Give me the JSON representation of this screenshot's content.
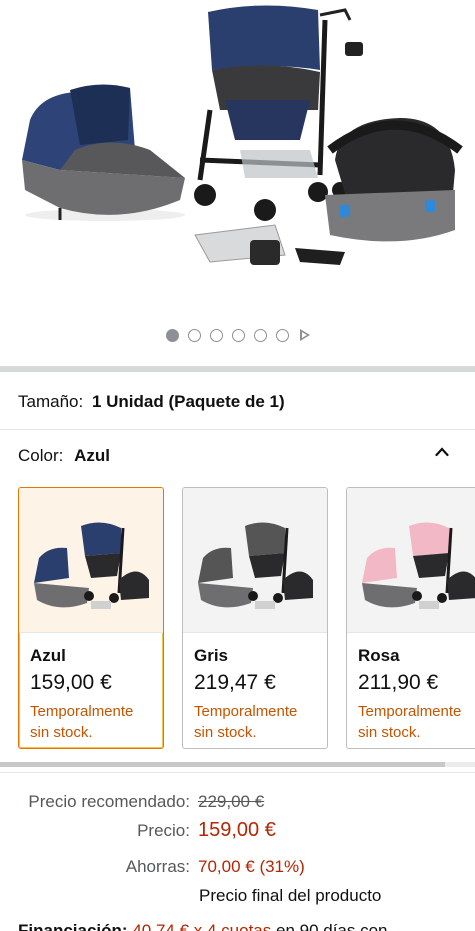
{
  "gallery": {
    "dots_total": 6,
    "active_index": 0,
    "play_icon": "play-icon"
  },
  "size": {
    "label": "Tamaño:",
    "value": "1 Unidad (Paquete de 1)"
  },
  "color": {
    "label": "Color:",
    "value": "Azul"
  },
  "swatches": [
    {
      "name": "Azul",
      "price": "159,00 €",
      "stock_line1": "Temporalmente",
      "stock_line2": "sin stock.",
      "accent": "#2b3f6e"
    },
    {
      "name": "Gris",
      "price": "219,47 €",
      "stock_line1": "Temporalmente",
      "stock_line2": "sin stock.",
      "accent": "#555555"
    },
    {
      "name": "Rosa",
      "price": "211,90 €",
      "stock_line1": "Temporalmente",
      "stock_line2": "sin stock.",
      "accent": "#f2b8c6"
    }
  ],
  "pricing": {
    "recommended_label": "Precio recomendado:",
    "recommended_value": "229,00 €",
    "price_label": "Precio:",
    "price_value": "159,00 €",
    "savings_label": "Ahorras:",
    "savings_value": "70,00 € (31%)",
    "final_note": "Precio final del producto"
  },
  "financing": {
    "label": "Financiación:",
    "link": "40,74 € x 4 cuotas",
    "rest": "en 90 días con"
  },
  "colors": {
    "price_red": "#b12704",
    "stock_orange": "#c45500",
    "selected_border": "#e77600"
  }
}
